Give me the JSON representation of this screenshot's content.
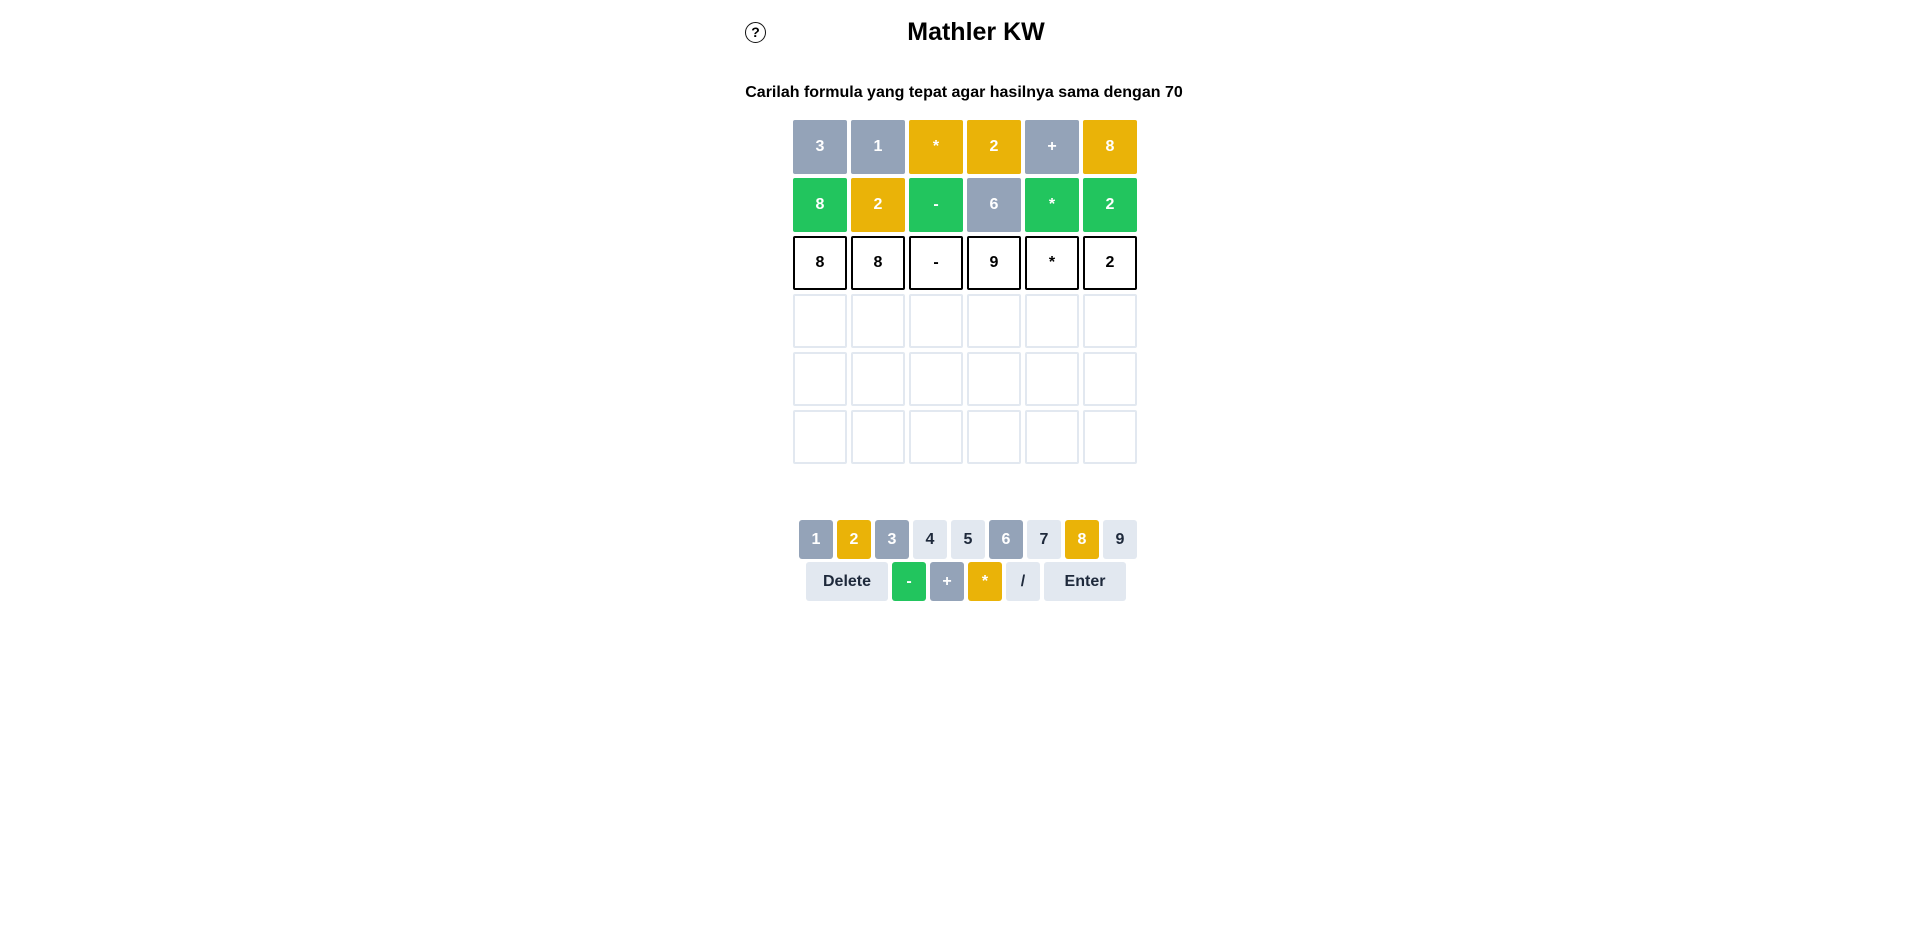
{
  "header": {
    "help_icon": "?",
    "title": "Mathler KW"
  },
  "instruction": "Carilah formula yang tepat agar hasilnya sama dengan 70",
  "colors": {
    "gray": "#94a3b8",
    "yellow": "#eab308",
    "green": "#22c55e",
    "key_default": "#e2e8f0"
  },
  "grid": {
    "rows": [
      [
        {
          "value": "3",
          "state": "gray"
        },
        {
          "value": "1",
          "state": "gray"
        },
        {
          "value": "*",
          "state": "yellow"
        },
        {
          "value": "2",
          "state": "yellow"
        },
        {
          "value": "+",
          "state": "gray"
        },
        {
          "value": "8",
          "state": "yellow"
        }
      ],
      [
        {
          "value": "8",
          "state": "green"
        },
        {
          "value": "2",
          "state": "yellow"
        },
        {
          "value": "-",
          "state": "green"
        },
        {
          "value": "6",
          "state": "gray"
        },
        {
          "value": "*",
          "state": "green"
        },
        {
          "value": "2",
          "state": "green"
        }
      ],
      [
        {
          "value": "8",
          "state": "typed"
        },
        {
          "value": "8",
          "state": "typed"
        },
        {
          "value": "-",
          "state": "typed"
        },
        {
          "value": "9",
          "state": "typed"
        },
        {
          "value": "*",
          "state": "typed"
        },
        {
          "value": "2",
          "state": "typed"
        }
      ],
      [
        {
          "value": "",
          "state": "empty"
        },
        {
          "value": "",
          "state": "empty"
        },
        {
          "value": "",
          "state": "empty"
        },
        {
          "value": "",
          "state": "empty"
        },
        {
          "value": "",
          "state": "empty"
        },
        {
          "value": "",
          "state": "empty"
        }
      ],
      [
        {
          "value": "",
          "state": "empty"
        },
        {
          "value": "",
          "state": "empty"
        },
        {
          "value": "",
          "state": "empty"
        },
        {
          "value": "",
          "state": "empty"
        },
        {
          "value": "",
          "state": "empty"
        },
        {
          "value": "",
          "state": "empty"
        }
      ],
      [
        {
          "value": "",
          "state": "empty"
        },
        {
          "value": "",
          "state": "empty"
        },
        {
          "value": "",
          "state": "empty"
        },
        {
          "value": "",
          "state": "empty"
        },
        {
          "value": "",
          "state": "empty"
        },
        {
          "value": "",
          "state": "empty"
        }
      ]
    ]
  },
  "keyboard": {
    "digits": [
      {
        "label": "1",
        "state": "gray"
      },
      {
        "label": "2",
        "state": "yellow"
      },
      {
        "label": "3",
        "state": "gray"
      },
      {
        "label": "4",
        "state": "default"
      },
      {
        "label": "5",
        "state": "default"
      },
      {
        "label": "6",
        "state": "gray"
      },
      {
        "label": "7",
        "state": "default"
      },
      {
        "label": "8",
        "state": "yellow"
      },
      {
        "label": "9",
        "state": "default"
      }
    ],
    "delete_label": "Delete",
    "operators": [
      {
        "label": "-",
        "state": "green"
      },
      {
        "label": "+",
        "state": "gray"
      },
      {
        "label": "*",
        "state": "yellow"
      },
      {
        "label": "/",
        "state": "default"
      }
    ],
    "enter_label": "Enter"
  }
}
